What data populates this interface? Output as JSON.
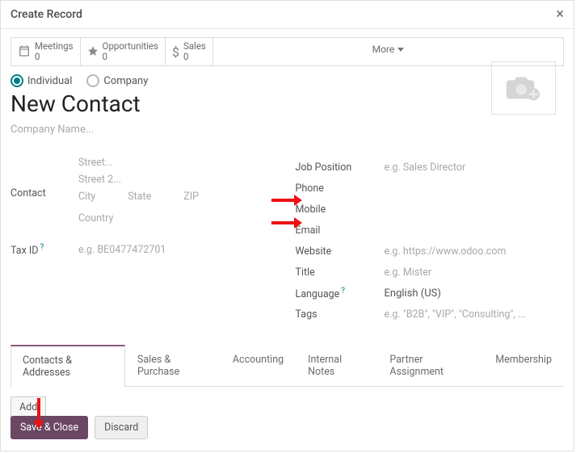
{
  "title": "Create Record",
  "stats": {
    "meetings": {
      "label": "Meetings",
      "value": "0"
    },
    "opportunities": {
      "label": "Opportunities",
      "value": "0"
    },
    "sales": {
      "label": "Sales",
      "value": "0"
    },
    "more": "More"
  },
  "radios": {
    "individual": "Individual",
    "company": "Company"
  },
  "heading": "New Contact",
  "company_ph": "Company Name...",
  "left": {
    "contact": "Contact",
    "street": "Street...",
    "street2": "Street 2...",
    "city": "City",
    "state": "State",
    "zip": "ZIP",
    "country": "Country",
    "taxid": "Tax ID",
    "taxid_ph": "e.g. BE0477472701"
  },
  "right": {
    "job": {
      "label": "Job Position",
      "ph": "e.g. Sales Director"
    },
    "phone": {
      "label": "Phone"
    },
    "mobile": {
      "label": "Mobile"
    },
    "email": {
      "label": "Email"
    },
    "website": {
      "label": "Website",
      "ph": "e.g. https://www.odoo.com"
    },
    "title": {
      "label": "Title",
      "ph": "e.g. Mister"
    },
    "language": {
      "label": "Language",
      "value": "English (US)"
    },
    "tags": {
      "label": "Tags",
      "ph": "e.g. \"B2B\", \"VIP\", \"Consulting\", ..."
    }
  },
  "tabs": [
    "Contacts & Addresses",
    "Sales & Purchase",
    "Accounting",
    "Internal Notes",
    "Partner Assignment",
    "Membership"
  ],
  "add": "Add",
  "footer": {
    "save": "Save & Close",
    "discard": "Discard"
  }
}
